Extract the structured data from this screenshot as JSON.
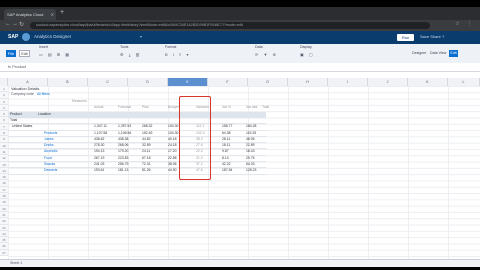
{
  "browser": {
    "tab_title": "SAP Analytics Cloud",
    "url": "sucloud.sapanalytics.cloud/sap/fpa/ui/tenants/c4/app.html#/story?shellMode=edit&/s/5A9C34E1A2B3D09B1F0048C7/?mode=edit"
  },
  "app": {
    "logo": "SAP",
    "title": "Analytics Designer",
    "header_button": "Run Story",
    "header_right": "Save  Share  ?"
  },
  "toolbar": {
    "file_label": "File",
    "edit_label": "Edit",
    "view_label": "View",
    "insert_label": "Insert",
    "tools_label": "Tools",
    "format_label": "Format",
    "data_label": "Data",
    "display_label": "Display",
    "right_items": [
      "Designer",
      "Data View"
    ],
    "right_button": "Edit"
  },
  "formula_bar": {
    "text": "fx  Product"
  },
  "columns": [
    "A",
    "B",
    "C",
    "D",
    "E",
    "F",
    "G",
    "H",
    "I",
    "J",
    "K",
    "L"
  ],
  "selected_column": "E",
  "table": {
    "title": "Valuation Details",
    "subtitle": "Company code",
    "filter": "All filters",
    "measure_header": "Measures",
    "measure_values": [
      "Actual",
      "Forecast",
      "Plan",
      "Budget",
      "Variance",
      "Var %",
      "Var abs",
      "Total"
    ],
    "group_header": "Product",
    "dimension_header": "Location",
    "rows": [
      {
        "label": "Total",
        "values": [
          "",
          "",
          "",
          "",
          "",
          "",
          "",
          ""
        ]
      },
      {
        "label": "United States",
        "values": [
          "1,347.11",
          "1,397.53",
          "268.32",
          "104.30",
          "112.1",
          "158.77",
          "184.28",
          "",
          ""
        ]
      },
      {
        "label": "Products",
        "values": [
          "1,107.58",
          "1,106.56",
          "152.49",
          "104.30",
          "102.3",
          "64.38",
          "119.25",
          ""
        ]
      },
      {
        "label": "Juices",
        "values": [
          "438.62",
          "438.38",
          "44.82",
          "40.18",
          "38.2",
          "28.11",
          "48.05",
          ""
        ]
      },
      {
        "label": "Drinks",
        "values": [
          "278.30",
          "268.06",
          "32.89",
          "24.18",
          "27.6",
          "18.11",
          "22.89",
          ""
        ]
      },
      {
        "label": "Alcoholic",
        "values": [
          "194.13",
          "179.20",
          "24.11",
          "17.20",
          "22.4",
          "9.87",
          "18.43",
          ""
        ]
      },
      {
        "label": "Food",
        "values": [
          "267.19",
          "223.83",
          "67.18",
          "22.58",
          "21.2",
          "8.14",
          "29.75",
          ""
        ]
      },
      {
        "label": "Snacks",
        "values": [
          "241.03",
          "256.79",
          "72.31",
          "38.06",
          "37.2",
          "42.22",
          "64.03",
          ""
        ]
      },
      {
        "label": "Desserts",
        "values": [
          "193.61",
          "181.13",
          "81.26",
          "44.90",
          "47.6",
          "187.54",
          "128.23",
          ""
        ]
      }
    ]
  },
  "statusbar": {
    "text": "Sheet 1"
  }
}
